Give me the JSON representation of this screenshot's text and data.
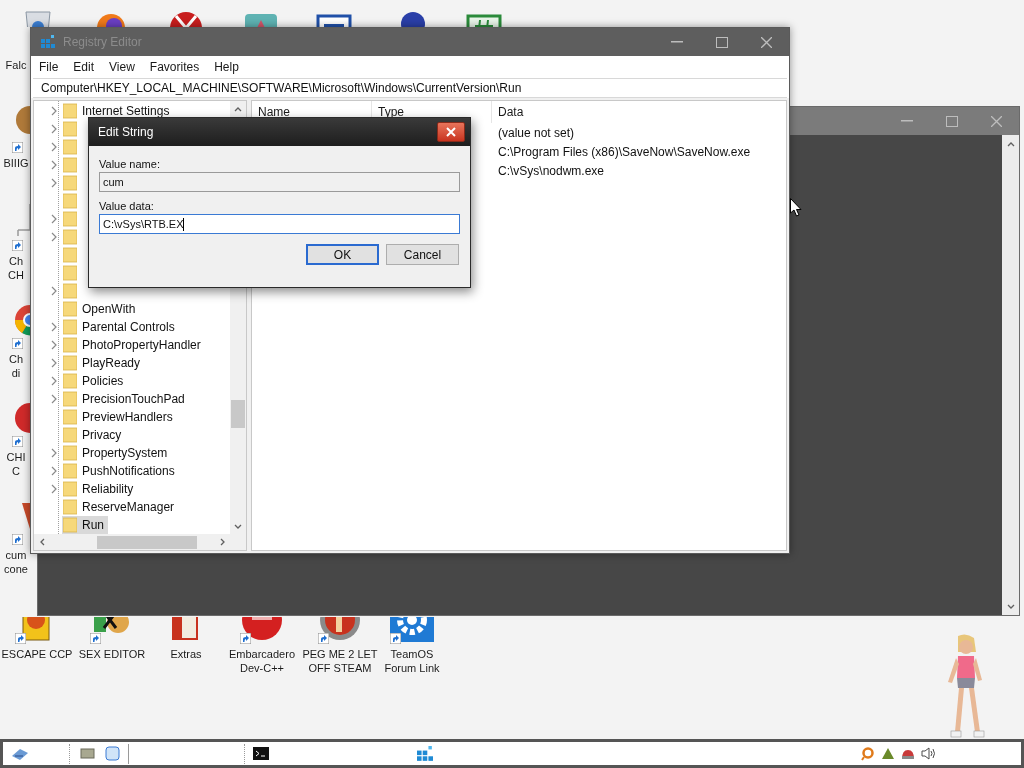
{
  "left_icons": [
    {
      "lines": [
        "Falc"
      ],
      "shortcut": false
    },
    {
      "lines": [
        "BIIIG"
      ],
      "shortcut": true
    },
    {
      "lines": [
        "Ch",
        "CH"
      ],
      "shortcut": true
    },
    {
      "lines": [
        "Ch",
        "di"
      ],
      "shortcut": true
    },
    {
      "lines": [
        "CHI",
        "C"
      ],
      "shortcut": true
    },
    {
      "lines": [
        "cum",
        "cone"
      ],
      "shortcut": true
    }
  ],
  "bottom_icons": [
    {
      "label": "ESCAPE CCP",
      "shortcut": true
    },
    {
      "label": "SEX EDITOR",
      "shortcut": true
    },
    {
      "label": "Extras",
      "shortcut": false
    },
    {
      "label": "Embarcadero Dev-C++",
      "shortcut": true
    },
    {
      "label": "PEG ME 2 LET OFF STEAM",
      "shortcut": true
    },
    {
      "label": "TeamOS Forum Link",
      "shortcut": true
    }
  ],
  "registry_editor": {
    "title": "Registry Editor",
    "menu": [
      "File",
      "Edit",
      "View",
      "Favorites",
      "Help"
    ],
    "address": "Computer\\HKEY_LOCAL_MACHINE\\SOFTWARE\\Microsoft\\Windows\\CurrentVersion\\Run",
    "tree": [
      {
        "label": "Internet Settings",
        "expandable": true,
        "selected": false
      },
      {
        "expandable": true,
        "selected": false
      },
      {
        "expandable": true,
        "selected": false
      },
      {
        "expandable": true,
        "selected": false
      },
      {
        "expandable": true,
        "selected": false
      },
      {
        "expandable": false,
        "selected": false
      },
      {
        "expandable": true,
        "selected": false
      },
      {
        "expandable": true,
        "selected": false
      },
      {
        "expandable": false,
        "selected": false
      },
      {
        "expandable": false,
        "selected": false
      },
      {
        "expandable": true,
        "selected": false
      },
      {
        "label": "OpenWith",
        "expandable": false,
        "selected": false
      },
      {
        "label": "Parental Controls",
        "expandable": true,
        "selected": false
      },
      {
        "label": "PhotoPropertyHandler",
        "expandable": true,
        "selected": false
      },
      {
        "label": "PlayReady",
        "expandable": true,
        "selected": false
      },
      {
        "label": "Policies",
        "expandable": true,
        "selected": false
      },
      {
        "label": "PrecisionTouchPad",
        "expandable": true,
        "selected": false
      },
      {
        "label": "PreviewHandlers",
        "expandable": false,
        "selected": false
      },
      {
        "label": "Privacy",
        "expandable": false,
        "selected": false
      },
      {
        "label": "PropertySystem",
        "expandable": true,
        "selected": false
      },
      {
        "label": "PushNotifications",
        "expandable": true,
        "selected": false
      },
      {
        "label": "Reliability",
        "expandable": true,
        "selected": false
      },
      {
        "label": "ReserveManager",
        "expandable": false,
        "selected": false
      },
      {
        "label": "Run",
        "expandable": false,
        "selected": true
      }
    ],
    "columns": [
      "Name",
      "Type",
      "Data"
    ],
    "rows": [
      {
        "data": "(value not set)"
      },
      {
        "data": "C:\\Program Files (x86)\\SaveNow\\SaveNow.exe"
      },
      {
        "data": "C:\\vSys\\nodwm.exe"
      }
    ]
  },
  "edit_string_dialog": {
    "title": "Edit String",
    "fields": [
      {
        "label": "Value name:",
        "value": "cum",
        "readonly": true,
        "focused": false
      },
      {
        "label": "Value data:",
        "value": "C:\\vSys\\RTB.EX",
        "readonly": false,
        "focused": true
      }
    ],
    "buttons": [
      {
        "label": "OK",
        "default": true
      },
      {
        "label": "Cancel",
        "default": false
      }
    ]
  }
}
